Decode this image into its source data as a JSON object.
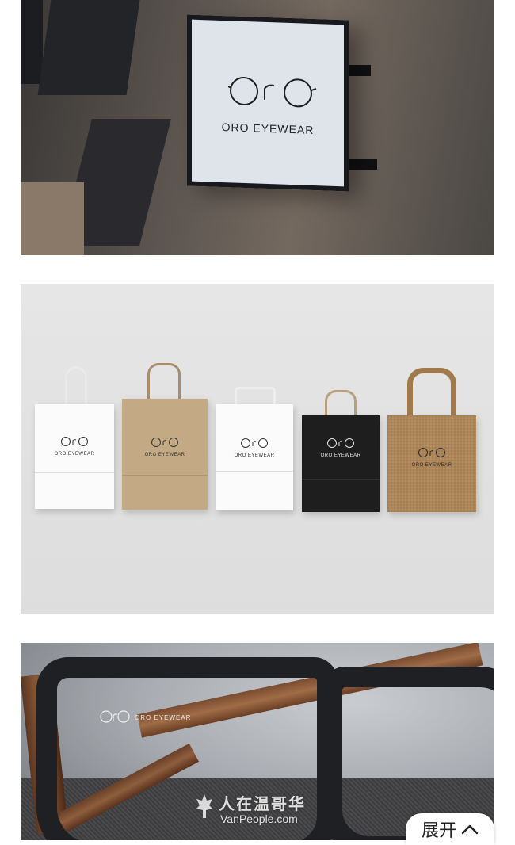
{
  "images": [
    {
      "caption": "",
      "sign": {
        "monogram": "OrO",
        "brand": "ORO EYEWEAR"
      }
    },
    {
      "caption": "",
      "bags": [
        {
          "color": "#ffffff",
          "label": "ORO EYEWEAR"
        },
        {
          "color": "#c4aa84",
          "label": "ORO EYEWEAR"
        },
        {
          "color": "#ffffff",
          "label": "ORO EYEWEAR"
        },
        {
          "color": "#1e1e1e",
          "label": "ORO EYEWEAR"
        },
        {
          "color": "#b58d5e",
          "label": "ORO EYEWEAR"
        }
      ]
    },
    {
      "caption": "",
      "lens_print": "ORO EYEWEAR"
    }
  ],
  "watermark": {
    "chinese": "人在温哥华",
    "english": "VanPeople.com"
  },
  "expand_button": {
    "label": "展开",
    "icon": "chevron-up-icon"
  },
  "colors": {
    "background": "#ffffff",
    "text": "#222222"
  }
}
